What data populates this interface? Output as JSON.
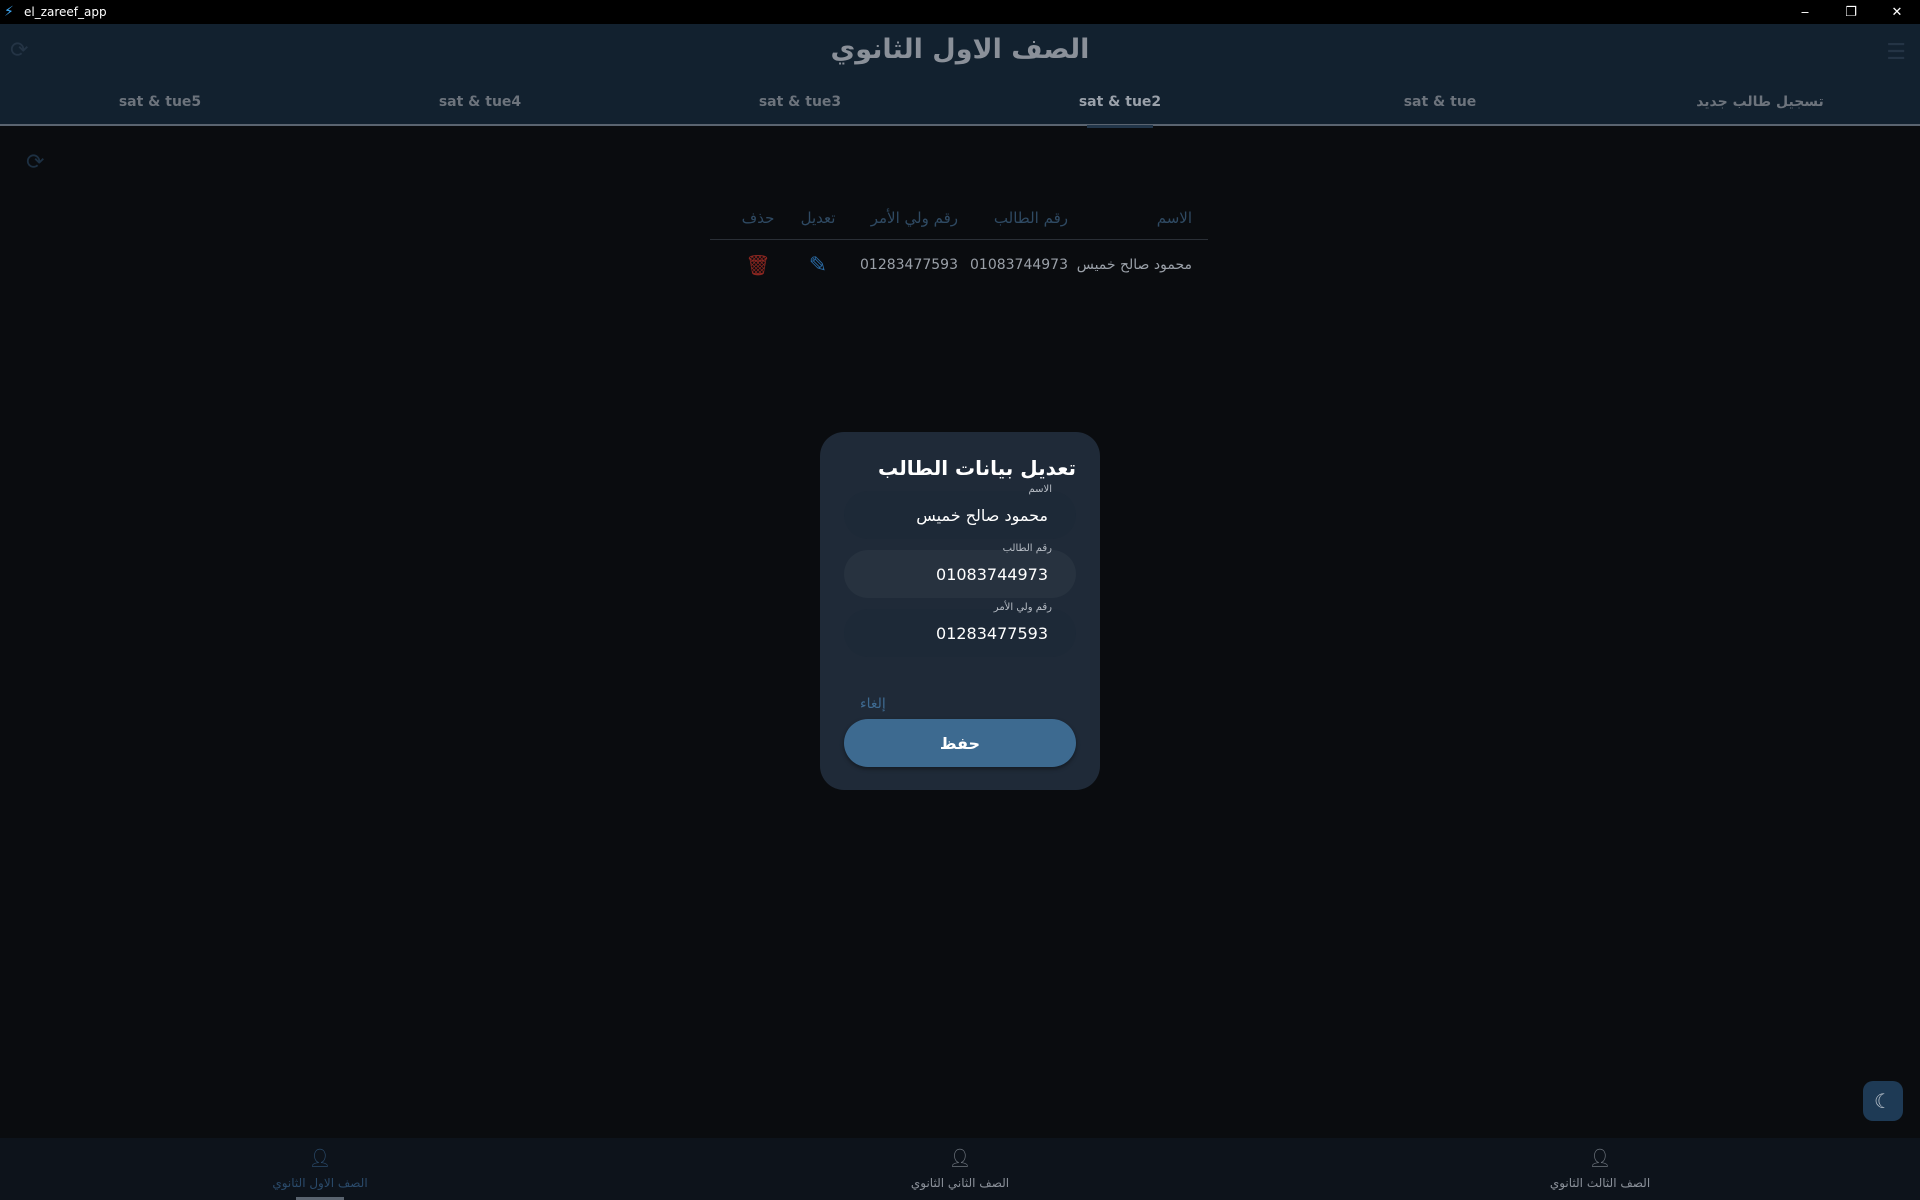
{
  "window": {
    "title": "el_zareef_app",
    "minimize": "‒",
    "restore": "❐",
    "close": "✕"
  },
  "appbar": {
    "title": "الصف الاول الثانوي"
  },
  "tabs": [
    {
      "label": "تسجيل طالب جديد"
    },
    {
      "label": "sat & tue"
    },
    {
      "label": "sat & tue2",
      "active": true
    },
    {
      "label": "sat & tue3"
    },
    {
      "label": "sat & tue4"
    },
    {
      "label": "sat & tue5"
    }
  ],
  "table": {
    "headers": [
      "الاسم",
      "رقم الطالب",
      "رقم ولي الأمر",
      "تعديل",
      "حذف"
    ],
    "rows": [
      {
        "name": "محمود صالح خميس",
        "student_phone": "01083744973",
        "parent_phone": "01283477593"
      }
    ]
  },
  "dialog": {
    "title": "تعديل بيانات الطالب",
    "fields": [
      {
        "label": "الاسم",
        "value": "محمود صالح خميس"
      },
      {
        "label": "رقم الطالب",
        "value": "01083744973"
      },
      {
        "label": "رقم ولي الأمر",
        "value": "01283477593"
      }
    ],
    "cancel": "إلغاء",
    "save": "حفظ"
  },
  "bottom_nav": [
    {
      "label": "الصف الاول الثانوي",
      "active": true
    },
    {
      "label": "الصف الثاني الثانوي"
    },
    {
      "label": "الصف الثالث الثانوي"
    }
  ],
  "colors": {
    "accent": "#3d6a90",
    "delete": "#8b2620",
    "appbar": "#12212f"
  }
}
